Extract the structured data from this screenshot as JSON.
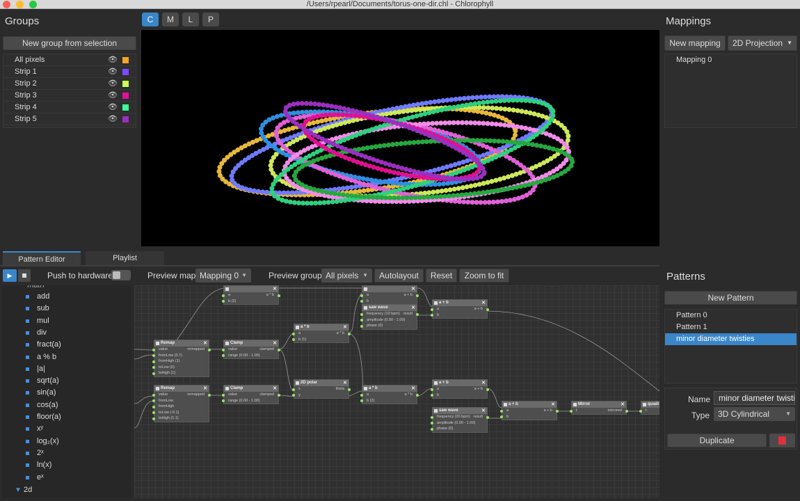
{
  "window": {
    "title": "/Users/rpearl/Documents/torus-one-dir.chl - Chlorophyll"
  },
  "colors": {
    "accent": "#3a86c8",
    "panel": "#2b2b2b",
    "pin": "#9be26b"
  },
  "groups": {
    "title": "Groups",
    "new_group_label": "New group from selection",
    "items": [
      {
        "label": "All pixels",
        "color": "#f5a623"
      },
      {
        "label": "Strip 1",
        "color": "#7b4cff"
      },
      {
        "label": "Strip 2",
        "color": "#c8ff50"
      },
      {
        "label": "Strip 3",
        "color": "#e0109a"
      },
      {
        "label": "Strip 4",
        "color": "#3dff9a"
      },
      {
        "label": "Strip 5",
        "color": "#9b2fbf"
      }
    ]
  },
  "view_modes": [
    "C",
    "M",
    "L",
    "P"
  ],
  "mappings": {
    "title": "Mappings",
    "new_label": "New mapping",
    "projection": "2D Projection",
    "items": [
      "Mapping 0"
    ]
  },
  "tabs": [
    "Pattern Editor",
    "Playlist"
  ],
  "toolbar": {
    "push_label": "Push to hardware",
    "preview_map_label": "Preview map",
    "preview_map_value": "Mapping 0",
    "preview_group_label": "Preview group",
    "preview_group_value": "All pixels",
    "autolayout": "Autolayout",
    "reset": "Reset",
    "zoom": "Zoom to fit"
  },
  "palette": {
    "section_top": "math",
    "items": [
      "add",
      "sub",
      "mul",
      "div",
      "fract(a)",
      "a % b",
      "|a|",
      "sqrt(a)",
      "sin(a)",
      "cos(a)",
      "floor(a)",
      "xʸ",
      "log₂(x)",
      "2ˣ",
      "ln(x)",
      "eˣ"
    ],
    "section_bottom": "2d"
  },
  "nodes": [
    {
      "title": "",
      "params": [
        "a",
        "b (2)"
      ],
      "outputs": [
        "a * b"
      ]
    },
    {
      "title": "",
      "params": [
        "a",
        "b"
      ],
      "outputs": [
        "a + b"
      ]
    },
    {
      "title": "a + b",
      "params": [
        "a",
        "b"
      ],
      "outputs": [
        "a + b"
      ]
    },
    {
      "title": "saw wave",
      "params": [
        "frequency (10 bpm)",
        "amplitude (0.00 - 1.00)",
        "phase (0)"
      ],
      "outputs": [
        "result"
      ]
    },
    {
      "title": "a * b",
      "params": [
        "a",
        "b (1)"
      ],
      "outputs": [
        "a * b"
      ]
    },
    {
      "title": "Remap",
      "params": [
        "value",
        "fromLow (0.7)",
        "fromHigh (1)",
        "toLow (0)",
        "toHigh (1)"
      ],
      "outputs": [
        "remapped"
      ]
    },
    {
      "title": "Clamp",
      "params": [
        "value",
        "range (0.00 - 1.00)"
      ],
      "outputs": [
        "clamped"
      ]
    },
    {
      "title": "2D polar",
      "params": [
        "x",
        "y"
      ],
      "outputs": [
        "theta"
      ]
    },
    {
      "title": "a * b",
      "params": [
        "a",
        "b (2)"
      ],
      "outputs": [
        "a * b"
      ]
    },
    {
      "title": "a + b",
      "params": [
        "a",
        "b"
      ],
      "outputs": [
        "a + b"
      ]
    },
    {
      "title": "Remap",
      "params": [
        "value",
        "fromLow",
        "fromHigh",
        "toLow (-0.1)",
        "toHigh (1.1)"
      ],
      "outputs": [
        "remapped"
      ]
    },
    {
      "title": "Clamp",
      "params": [
        "value",
        "range (0.00 - 1.00)"
      ],
      "outputs": [
        "clamped"
      ]
    },
    {
      "title": "saw wave",
      "params": [
        "frequency (20 bpm)",
        "amplitude (0.00 - 1.00)",
        "phase (0)"
      ],
      "outputs": [
        "result"
      ]
    },
    {
      "title": "a + b",
      "params": [
        "a",
        "b"
      ],
      "outputs": [
        "a + b"
      ]
    },
    {
      "title": "Mirror",
      "params": [
        "t"
      ],
      "outputs": [
        "mirrored"
      ]
    },
    {
      "title": "quadr",
      "params": [
        "t"
      ],
      "outputs": [
        ""
      ]
    }
  ],
  "patterns": {
    "title": "Patterns",
    "new_label": "New Pattern",
    "items": [
      "Pattern 0",
      "Pattern 1",
      "minor diameter twisties"
    ],
    "selected_index": 2,
    "name_label": "Name",
    "name_value": "minor diameter twisties",
    "type_label": "Type",
    "type_value": "3D Cylindrical",
    "duplicate_label": "Duplicate"
  }
}
